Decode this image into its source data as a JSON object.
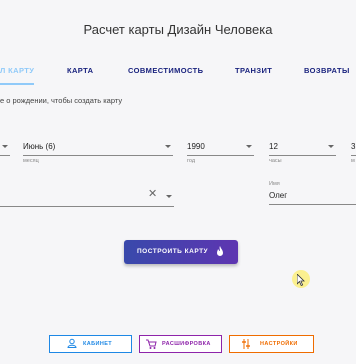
{
  "page": {
    "title": "Расчет карты Дизайн Человека"
  },
  "tabs": [
    {
      "label": "Л КАРТУ",
      "active": true
    },
    {
      "label": "КАРТА"
    },
    {
      "label": "СОВМЕСТИМОСТЬ"
    },
    {
      "label": "ТРАНЗИТ"
    },
    {
      "label": "ВОЗВРАТЫ"
    }
  ],
  "form": {
    "hint": "е о рождении, чтобы создать карту",
    "month": {
      "value": "Июнь (6)",
      "helper": "месяц"
    },
    "year": {
      "value": "1990",
      "helper": "год"
    },
    "hour": {
      "value": "12",
      "helper": "часы"
    },
    "minute": {
      "value": "3",
      "helper": "м"
    },
    "name": {
      "label": "Имя",
      "value": "Олег"
    }
  },
  "build_button": {
    "label": "ПОСТРОИТЬ КАРТУ"
  },
  "bottom_buttons": [
    {
      "label": "КАБИНЕТ",
      "color": "#1e88e5"
    },
    {
      "label": "РАСШИФРОВКА",
      "color": "#8e24aa"
    },
    {
      "label": "НАСТРОЙКИ",
      "color": "#ef6c00"
    }
  ],
  "colors": {
    "accent": "#3949ab",
    "tab_text": "#1a237e",
    "active_tab": "#90caf9"
  }
}
